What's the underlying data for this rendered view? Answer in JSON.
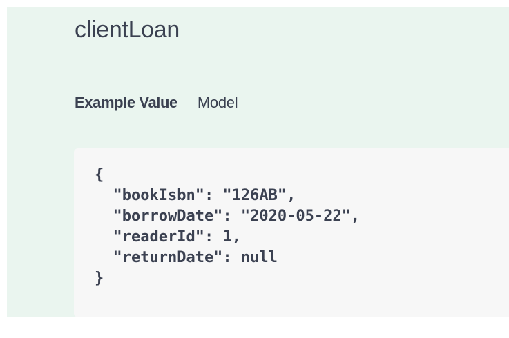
{
  "model": {
    "title": "clientLoan"
  },
  "tabs": {
    "example_value": "Example Value",
    "model": "Model"
  },
  "example": {
    "open_brace": "{",
    "lines": [
      "  \"bookIsbn\": \"126AB\",",
      "  \"borrowDate\": \"2020-05-22\",",
      "  \"readerId\": 1,",
      "  \"returnDate\": null"
    ],
    "close_brace": "}"
  },
  "colors": {
    "panel_background": "#eaf5ef",
    "code_background": "#f7f7f7",
    "text": "#3b4151"
  }
}
